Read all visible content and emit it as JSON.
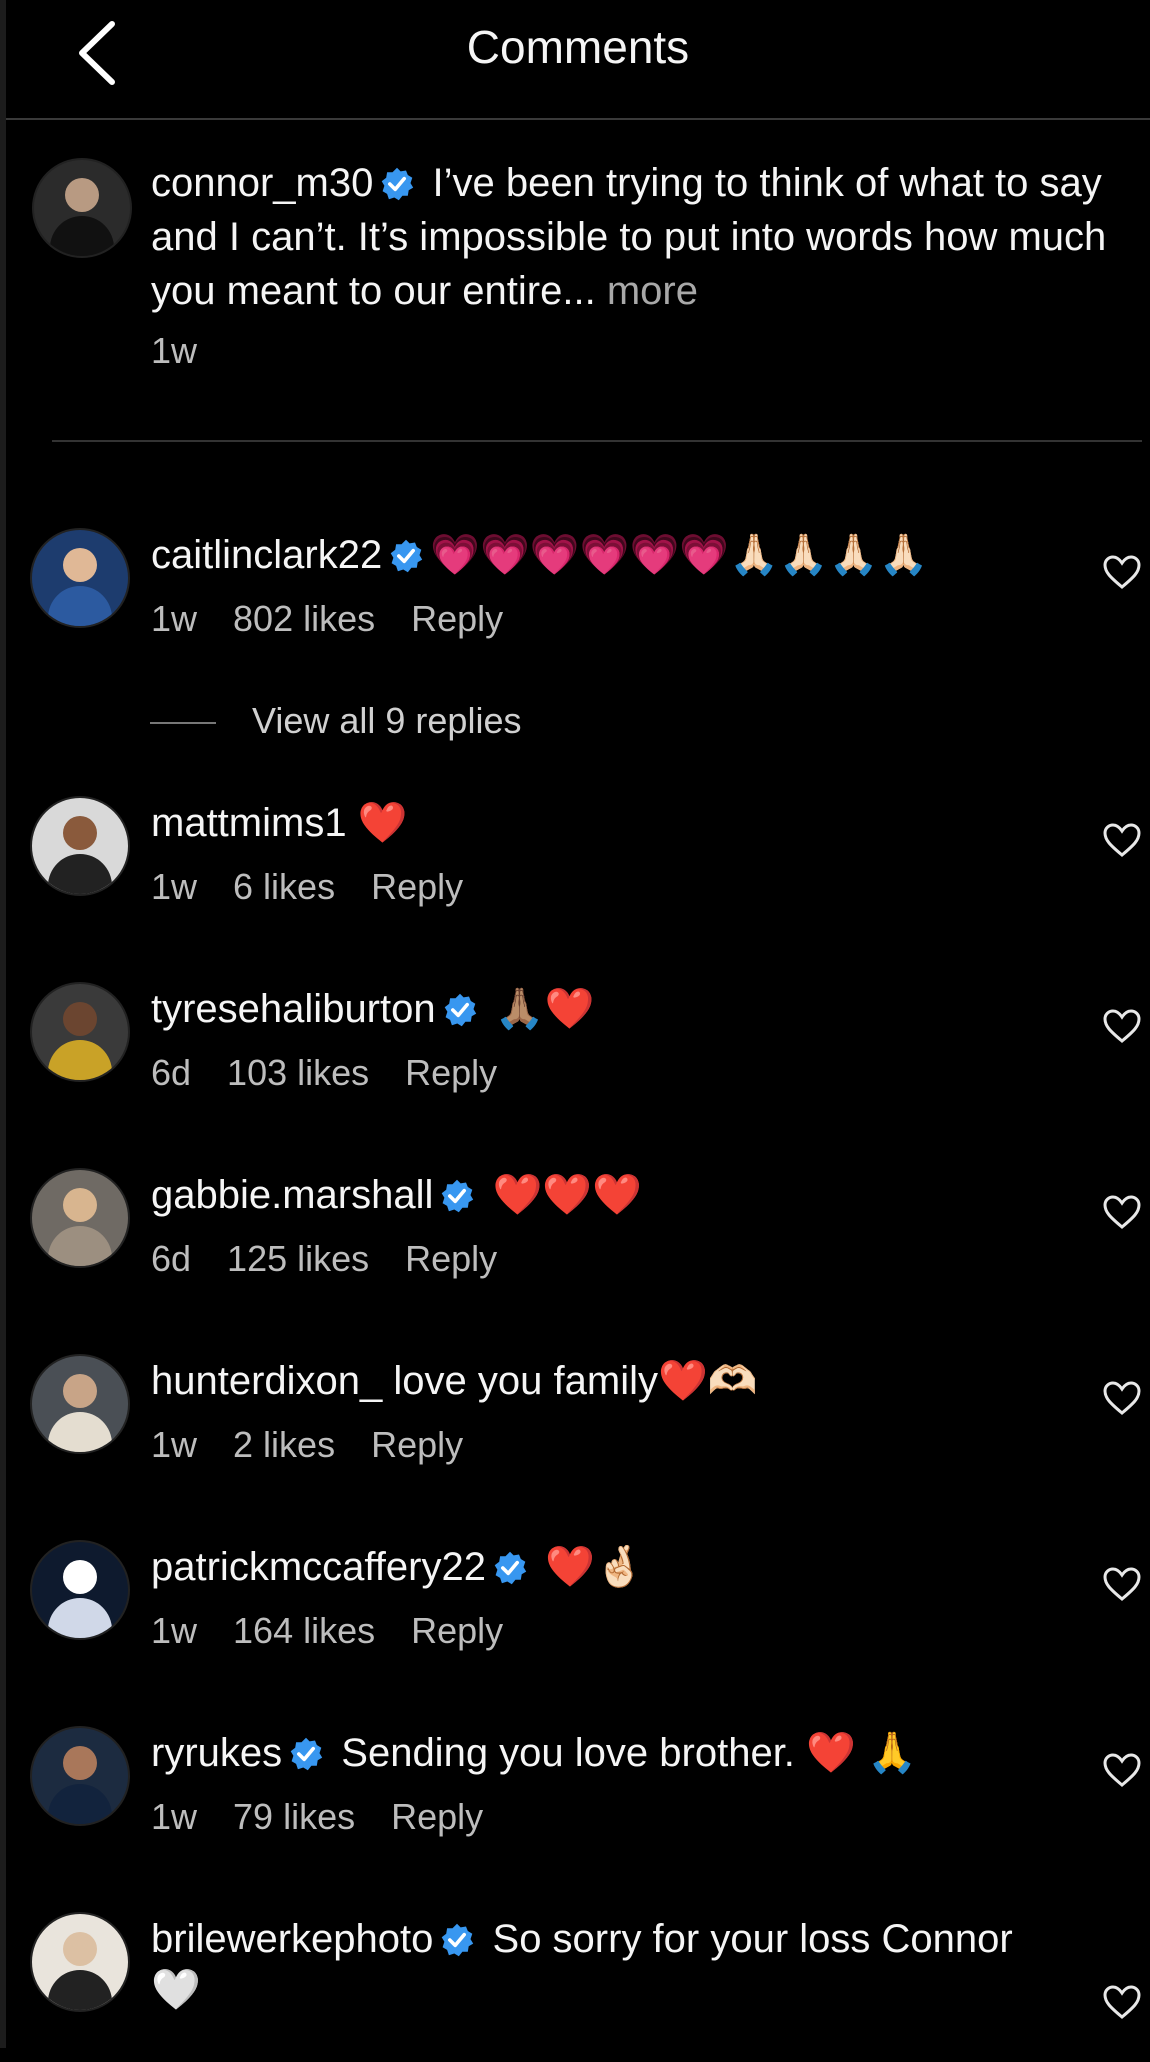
{
  "header": {
    "title": "Comments"
  },
  "caption": {
    "username": "connor_m30",
    "text": "I’ve been trying to think of what to say and I can’t. It’s impossible to put into words how much you meant to our entire...",
    "more_label": "more",
    "time": "1w"
  },
  "comments": [
    {
      "username": "caitlinclark22",
      "verified": true,
      "text": "💗💗💗💗💗💗🙏🏻🙏🏻🙏🏻🙏🏻",
      "time": "1w",
      "likes": "802 likes",
      "reply": "Reply"
    },
    {
      "username": "mattmims1",
      "verified": false,
      "text": "❤️",
      "time": "1w",
      "likes": "6 likes",
      "reply": "Reply"
    },
    {
      "username": "tyresehaliburton",
      "verified": true,
      "text": "🙏🏽❤️",
      "time": "6d",
      "likes": "103 likes",
      "reply": "Reply"
    },
    {
      "username": "gabbie.marshall",
      "verified": true,
      "text": "❤️❤️❤️",
      "time": "6d",
      "likes": "125 likes",
      "reply": "Reply"
    },
    {
      "username": "hunterdixon_",
      "verified": false,
      "text": "love you family❤️🫶🏻",
      "time": "1w",
      "likes": "2 likes",
      "reply": "Reply"
    },
    {
      "username": "patrickmccaffery22",
      "verified": true,
      "text": "❤️🤞🏻",
      "time": "1w",
      "likes": "164 likes",
      "reply": "Reply"
    },
    {
      "username": "ryrukes",
      "verified": true,
      "text": "Sending you love brother. ❤️ 🙏",
      "time": "1w",
      "likes": "79 likes",
      "reply": "Reply"
    },
    {
      "username": "brilewerkephoto",
      "verified": true,
      "text": "So sorry for your loss Connor",
      "text2": "🤍"
    }
  ],
  "view_replies": "View all 9 replies",
  "colors": {
    "verified": "#3897f0",
    "background": "#000000"
  }
}
